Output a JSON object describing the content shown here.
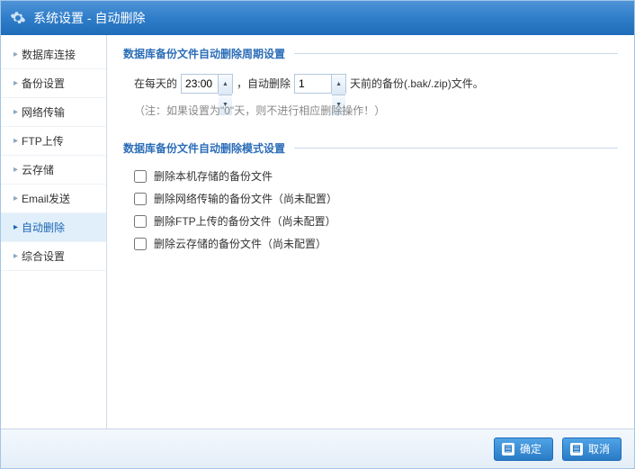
{
  "title": "系统设置 - 自动删除",
  "sidebar": {
    "items": [
      {
        "label": "数据库连接"
      },
      {
        "label": "备份设置"
      },
      {
        "label": "网络传输"
      },
      {
        "label": "FTP上传"
      },
      {
        "label": "云存储"
      },
      {
        "label": "Email发送"
      },
      {
        "label": "自动删除"
      },
      {
        "label": "综合设置"
      }
    ]
  },
  "section1": {
    "legend": "数据库备份文件自动删除周期设置",
    "prefix": "在每天的",
    "time_value": "23:00",
    "mid": "，自动删除",
    "days_value": "1",
    "suffix": "天前的备份(.bak/.zip)文件。",
    "note": "（注：如果设置为\"0\"天，则不进行相应删除操作！）"
  },
  "section2": {
    "legend": "数据库备份文件自动删除模式设置",
    "options": [
      {
        "label": "删除本机存储的备份文件"
      },
      {
        "label": "删除网络传输的备份文件（尚未配置）"
      },
      {
        "label": "删除FTP上传的备份文件（尚未配置）"
      },
      {
        "label": "删除云存储的备份文件（尚未配置）"
      }
    ]
  },
  "buttons": {
    "ok": "确定",
    "cancel": "取消"
  }
}
